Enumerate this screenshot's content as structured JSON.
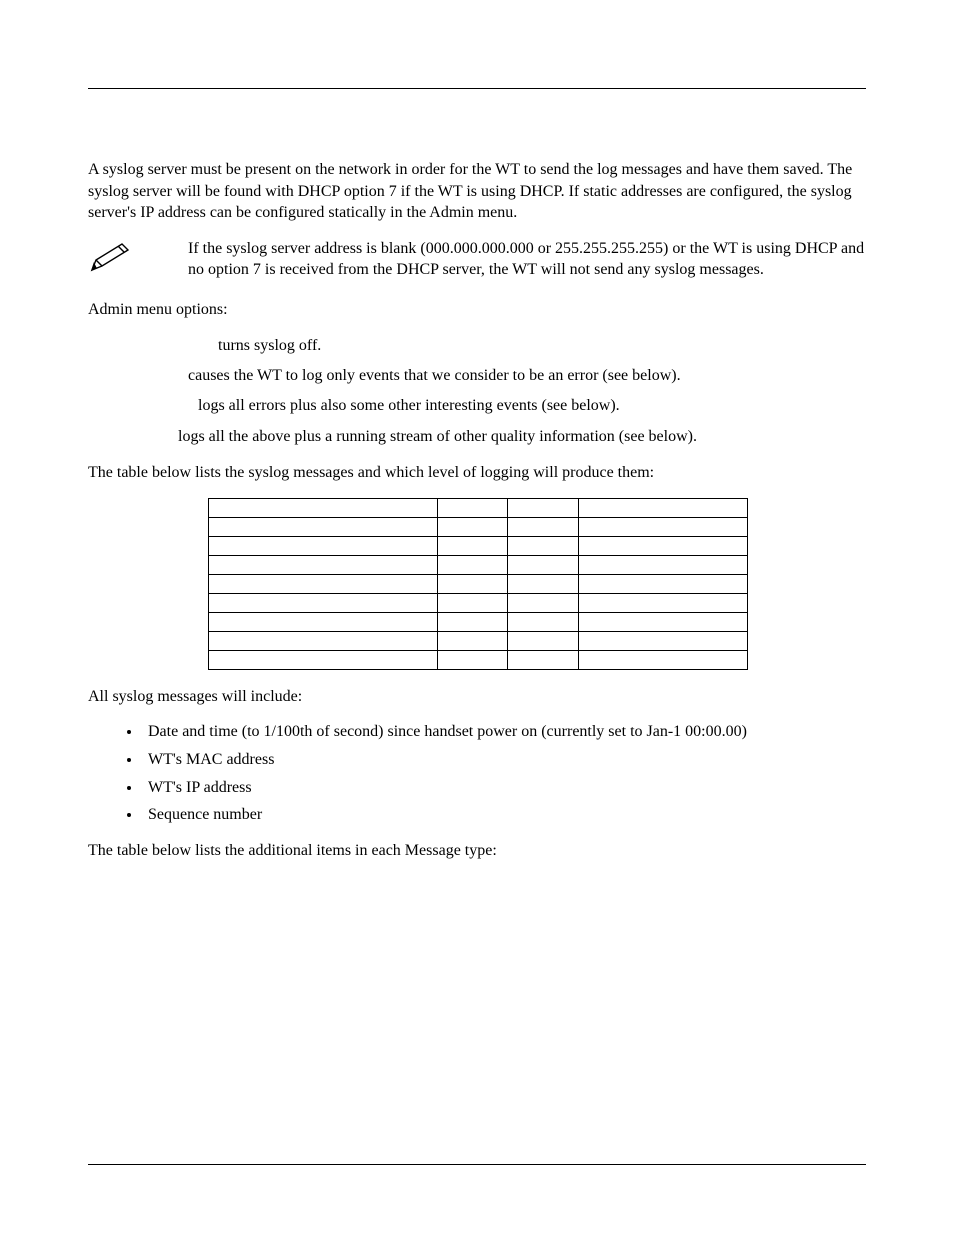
{
  "para1": "A syslog server must be present on the network in order for the WT to send the log messages and have them saved. The syslog server will be found with DHCP option 7 if the WT is using DHCP. If static addresses are configured, the syslog server's IP address can be configured statically in the Admin menu.",
  "note": "If the syslog server address is blank (000.000.000.000 or 255.255.255.255) or the WT is using DHCP and no option 7 is received from the DHCP server, the WT will not send any syslog messages.",
  "admin_heading": "Admin menu options:",
  "options": {
    "off": "turns syslog off.",
    "errors": "causes the WT to log only events that we consider to be an error (see below).",
    "events": "logs all errors plus also some other interesting events (see below).",
    "full": "logs all the above plus a running stream of other quality information (see below)."
  },
  "table_intro": "The table below lists the syslog messages and which level of logging will produce them:",
  "table_rows": 9,
  "includes_intro": "All syslog messages will include:",
  "includes": [
    "Date and time (to 1/100th of second) since handset power on (currently set to Jan-1 00:00.00)",
    "WT's MAC address",
    "WT's IP address",
    "Sequence number"
  ],
  "closing": "The table below lists the additional items in each Message type:"
}
